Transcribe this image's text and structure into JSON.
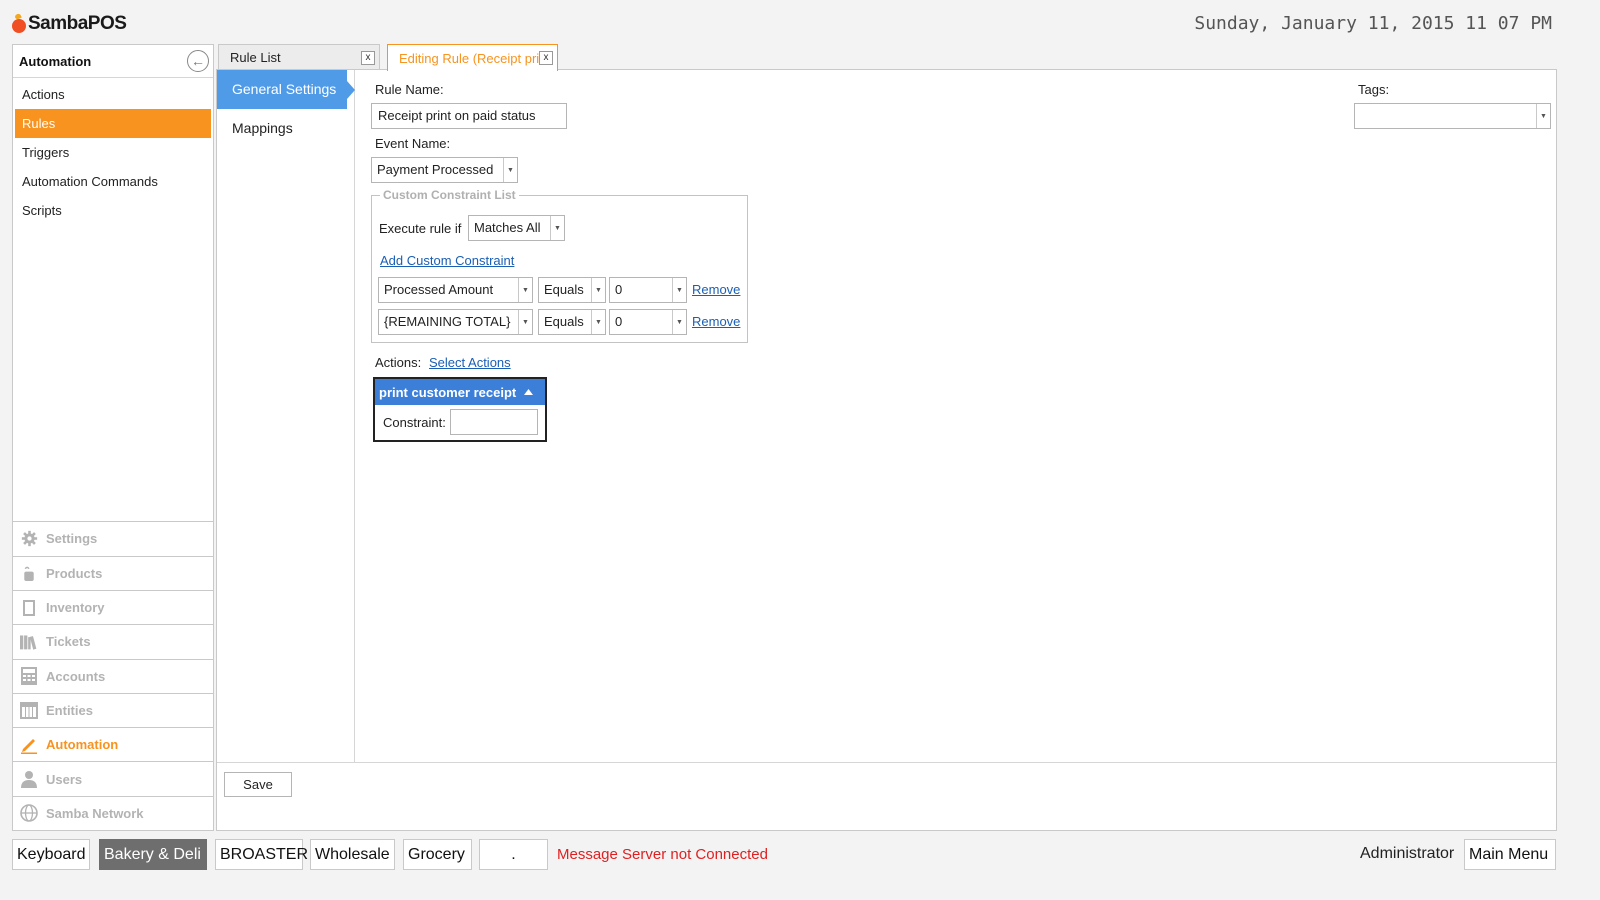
{
  "app": {
    "logo_text": "SambaPOS",
    "datetime": "Sunday, January 11, 2015 11 07 PM"
  },
  "sidebar": {
    "title": "Automation",
    "items": [
      {
        "label": "Actions"
      },
      {
        "label": "Rules",
        "active": true
      },
      {
        "label": "Triggers"
      },
      {
        "label": "Automation Commands"
      },
      {
        "label": "Scripts"
      }
    ],
    "modules": [
      {
        "label": "Settings",
        "icon": "gear-icon"
      },
      {
        "label": "Products",
        "icon": "coffee-cup-icon"
      },
      {
        "label": "Inventory",
        "icon": "box-icon"
      },
      {
        "label": "Tickets",
        "icon": "books-icon"
      },
      {
        "label": "Accounts",
        "icon": "calculator-icon"
      },
      {
        "label": "Entities",
        "icon": "calendar-icon"
      },
      {
        "label": "Automation",
        "icon": "pencil-icon",
        "active": true
      },
      {
        "label": "Users",
        "icon": "user-icon"
      },
      {
        "label": "Samba Network",
        "icon": "globe-icon"
      }
    ]
  },
  "tabs": [
    {
      "label": "Rule List",
      "close": "x"
    },
    {
      "label": "Editing Rule (Receipt print on paid status)",
      "close": "x",
      "active": true
    }
  ],
  "side_tabs": [
    {
      "label": "General Settings",
      "active": true
    },
    {
      "label": "Mappings"
    }
  ],
  "form": {
    "rule_name_label": "Rule Name:",
    "rule_name_value": "Receipt print on paid status",
    "event_name_label": "Event Name:",
    "event_name_value": "Payment Processed",
    "tags_label": "Tags:",
    "tags_value": "",
    "constraint_group_title": "Custom Constraint List",
    "execute_rule_label": "Execute rule if",
    "execute_rule_value": "Matches All",
    "add_constraint_link": "Add Custom Constraint",
    "constraints": [
      {
        "field": "Processed Amount",
        "operator": "Equals",
        "value": "0",
        "remove": "Remove"
      },
      {
        "field": "{REMAINING TOTAL}",
        "operator": "Equals",
        "value": "0",
        "remove": "Remove"
      }
    ],
    "actions_label": "Actions:",
    "select_actions_link": "Select Actions",
    "action_item": {
      "name": "print customer receipt",
      "constraint_label": "Constraint:",
      "constraint_value": ""
    },
    "save_label": "Save"
  },
  "bottom_bar": {
    "buttons": [
      "Keyboard",
      "Bakery & Deli",
      "BROASTER",
      "Wholesale",
      "Grocery",
      "."
    ],
    "message": "Message Server not Connected",
    "user": "Administrator",
    "main_menu": "Main Menu"
  },
  "colors": {
    "accent": "#f7931e",
    "selected_tab": "#4f9be8",
    "action_header": "#3c7fd9",
    "error": "#e02020"
  }
}
